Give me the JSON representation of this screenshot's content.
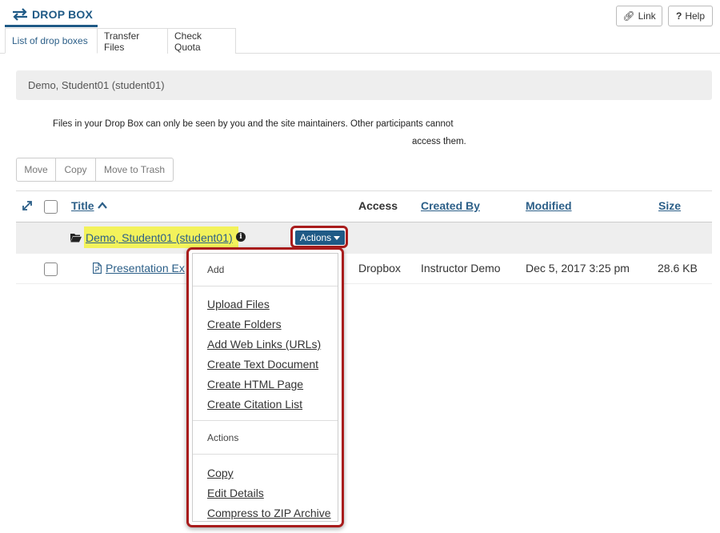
{
  "header": {
    "tool_title": "DROP BOX",
    "link_label": "Link",
    "help_label": "Help"
  },
  "tabs": [
    {
      "label": "List of drop boxes",
      "active": true
    },
    {
      "label": "Transfer Files",
      "active": false
    },
    {
      "label": "Check Quota",
      "active": false
    }
  ],
  "owner_panel": "Demo, Student01 (student01)",
  "notice": {
    "line1": "Files in your Drop Box can only be seen by you and the site maintainers. Other participants cannot",
    "line2": "access them."
  },
  "toolbar": {
    "buttons": [
      "Move",
      "Copy",
      "Move to Trash"
    ]
  },
  "table": {
    "columns": {
      "title": "Title",
      "access": "Access",
      "created_by": "Created By",
      "modified": "Modified",
      "size": "Size"
    },
    "folder_row": {
      "name": "Demo, Student01 (student01)",
      "actions_label": "Actions"
    },
    "file_row": {
      "name": "Presentation Ex",
      "access": "Dropbox",
      "created_by": "Instructor Demo",
      "modified": "Dec 5, 2017 3:25 pm",
      "size": "28.6 KB"
    }
  },
  "menu": {
    "add_header": "Add",
    "add_items": [
      "Upload Files",
      "Create Folders",
      "Add Web Links (URLs)",
      "Create Text Document",
      "Create HTML Page",
      "Create Citation List"
    ],
    "actions_header": "Actions",
    "action_items": [
      "Copy",
      "Edit Details",
      "Compress to ZIP Archive"
    ]
  },
  "colors": {
    "accent": "#1f5a86",
    "highlight": "#f3f25b",
    "callout": "#a81c1c",
    "link": "#2c5f88"
  },
  "icons": [
    "swap-arrows-icon",
    "link-icon",
    "help-icon",
    "expand-icon",
    "sort-up-icon",
    "folder-icon",
    "info-icon",
    "caret-down-icon",
    "file-icon"
  ]
}
